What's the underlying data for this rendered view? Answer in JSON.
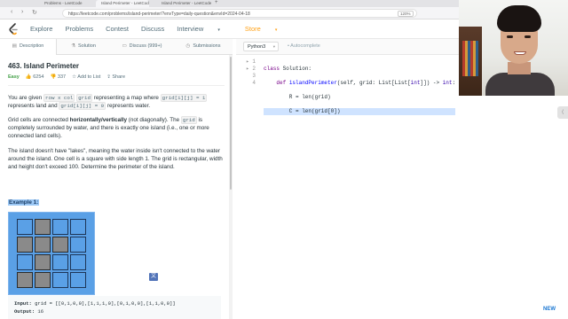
{
  "browser": {
    "tabs": [
      {
        "label": "Problems - LeetCode"
      },
      {
        "label": "Island Perimeter - LeetCode"
      },
      {
        "label": "Island Perimeter - LeetCode"
      }
    ],
    "url": "https://leetcode.com/problems/island-perimeter/?envType=daily-question&envId=2024-04-18",
    "zoom": "120%"
  },
  "site_nav": {
    "items": [
      "Explore",
      "Problems",
      "Contest",
      "Discuss",
      "Interview",
      "Store"
    ]
  },
  "description_tabs": [
    {
      "label": "Description",
      "icon": "doc-icon"
    },
    {
      "label": "Solution",
      "icon": "flask-icon"
    },
    {
      "label": "Discuss (999+)",
      "icon": "chat-icon"
    },
    {
      "label": "Submissions",
      "icon": "clock-icon"
    }
  ],
  "problem": {
    "title": "463. Island Perimeter",
    "difficulty": "Easy",
    "likes": "6254",
    "dislikes": "337",
    "add_to_list": "Add to List",
    "share": "Share",
    "p1_a": "You are given ",
    "p1_code1": "row x col",
    "p1_b": " ",
    "p1_code2": "grid",
    "p1_c": " representing a map where ",
    "p1_code3": "grid[i][j] = 1",
    "p1_d": " represents land and ",
    "p1_code4": "grid[i][j] = 0",
    "p1_e": " represents water.",
    "p2_a": "Grid cells are connected ",
    "p2_bold": "horizontally/vertically",
    "p2_b": " (not diagonally). The ",
    "p2_code": "grid",
    "p2_c": " is completely surrounded by water, and there is exactly one island (i.e., one or more connected land cells).",
    "p3": "The island doesn't have \"lakes\", meaning the water inside isn't connected to the water around the island. One cell is a square with side length 1. The grid is rectangular, width and height don't exceed 100. Determine the perimeter of the island.",
    "example_title": "Example 1:",
    "example_grid": [
      [
        0,
        1,
        0,
        0
      ],
      [
        1,
        1,
        1,
        0
      ],
      [
        0,
        1,
        0,
        0
      ],
      [
        1,
        1,
        0,
        0
      ]
    ],
    "input_label": "Input:",
    "input_value": "grid = [[0,1,0,0],[1,1,1,0],[0,1,0,0],[1,1,0,0]]",
    "output_label": "Output:",
    "output_value": "16"
  },
  "editor": {
    "language": "Python3",
    "autocomplete": "Autocomplete",
    "line_numbers": [
      "1",
      "2",
      "3",
      "4"
    ],
    "code": {
      "l1_kw": "class",
      "l1_rest": " Solution:",
      "l2_indent": "    ",
      "l2_kw": "def",
      "l2_fn": " islandPerimeter",
      "l2_a": "(self, grid: List[List[",
      "l2_bt": "int",
      "l2_b": "]]) -> ",
      "l2_bt2": "int",
      "l2_c": ":",
      "l3": "        R = len(grid)",
      "l4": "        C = len(grid[0])"
    }
  },
  "new_badge": "NEW"
}
